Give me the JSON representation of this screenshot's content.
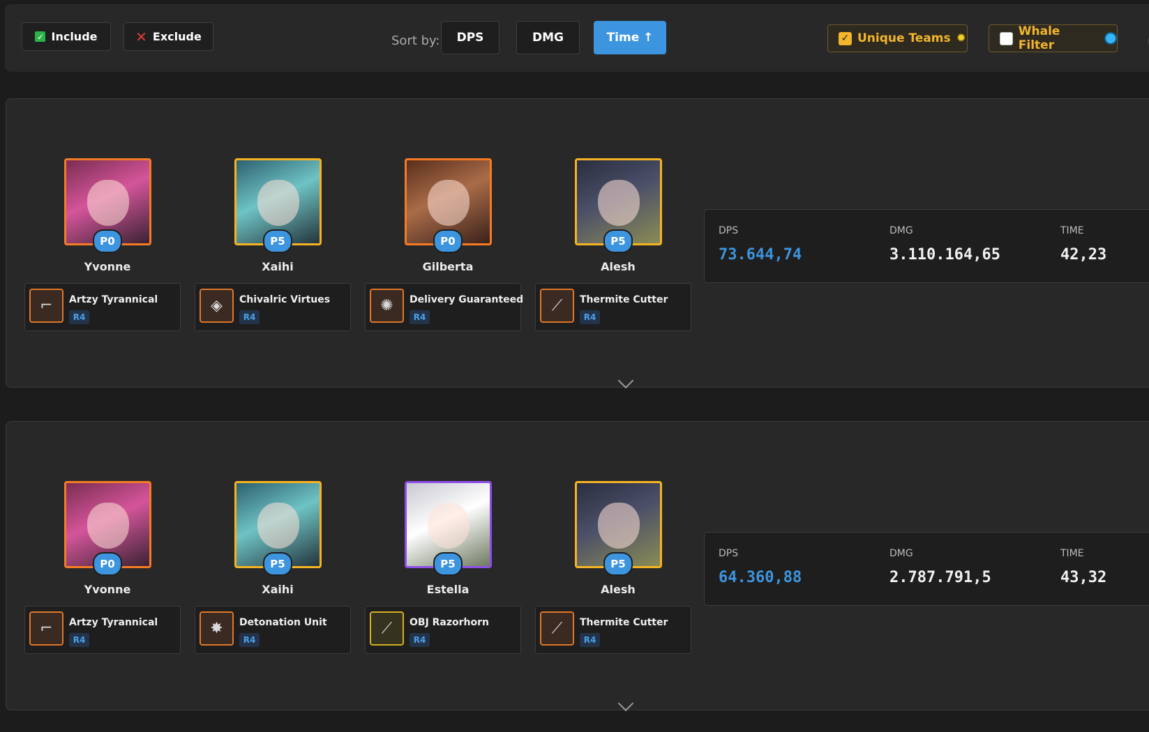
{
  "toolbar": {
    "include_label": "Include",
    "exclude_label": "Exclude",
    "sort_label": "Sort by:",
    "sort_options": [
      "DPS",
      "DMG",
      "Time ↑"
    ],
    "active_sort": "Time ↑",
    "unique_teams_label": "Unique Teams",
    "unique_teams_checked": true,
    "whale_filter_label": "Whale Filter",
    "whale_filter_checked": false,
    "accent_color": "#3d95df",
    "filter_color": "#f2b52c"
  },
  "teams": [
    {
      "characters": [
        {
          "name": "Yvonne",
          "potential": "P0",
          "rarity_color": "#f57b25",
          "weapon": {
            "name": "Artzy Tyrannical",
            "rank": "R4",
            "icon": "gun-icon"
          }
        },
        {
          "name": "Xaihi",
          "potential": "P5",
          "rarity_color": "#f5b324",
          "weapon": {
            "name": "Chivalric Virtues",
            "rank": "R4",
            "icon": "gauntlet-icon"
          }
        },
        {
          "name": "Gilberta",
          "potential": "P0",
          "rarity_color": "#f57b25",
          "weapon": {
            "name": "Delivery Guaranteed",
            "rank": "R4",
            "icon": "device-icon"
          }
        },
        {
          "name": "Alesh",
          "potential": "P5",
          "rarity_color": "#f5b324",
          "weapon": {
            "name": "Thermite Cutter",
            "rank": "R4",
            "icon": "blade-icon"
          }
        }
      ],
      "stats": {
        "dps_label": "DPS",
        "dps": "73.644,74",
        "dmg_label": "DMG",
        "dmg": "3.110.164,65",
        "time_label": "TIME",
        "time": "42,23"
      }
    },
    {
      "characters": [
        {
          "name": "Yvonne",
          "potential": "P0",
          "rarity_color": "#f57b25",
          "weapon": {
            "name": "Artzy Tyrannical",
            "rank": "R4",
            "icon": "gun-icon"
          }
        },
        {
          "name": "Xaihi",
          "potential": "P5",
          "rarity_color": "#f5b324",
          "weapon": {
            "name": "Detonation Unit",
            "rank": "R4",
            "icon": "bomb-icon"
          }
        },
        {
          "name": "Estella",
          "potential": "P5",
          "rarity_color": "#8e4ee8",
          "weapon": {
            "name": "OBJ Razorhorn",
            "rank": "R4",
            "icon": "spear-icon"
          }
        },
        {
          "name": "Alesh",
          "potential": "P5",
          "rarity_color": "#f5b324",
          "weapon": {
            "name": "Thermite Cutter",
            "rank": "R4",
            "icon": "blade-icon"
          }
        }
      ],
      "stats": {
        "dps_label": "DPS",
        "dps": "64.360,88",
        "dmg_label": "DMG",
        "dmg": "2.787.791,5",
        "time_label": "TIME",
        "time": "43,32"
      }
    }
  ]
}
